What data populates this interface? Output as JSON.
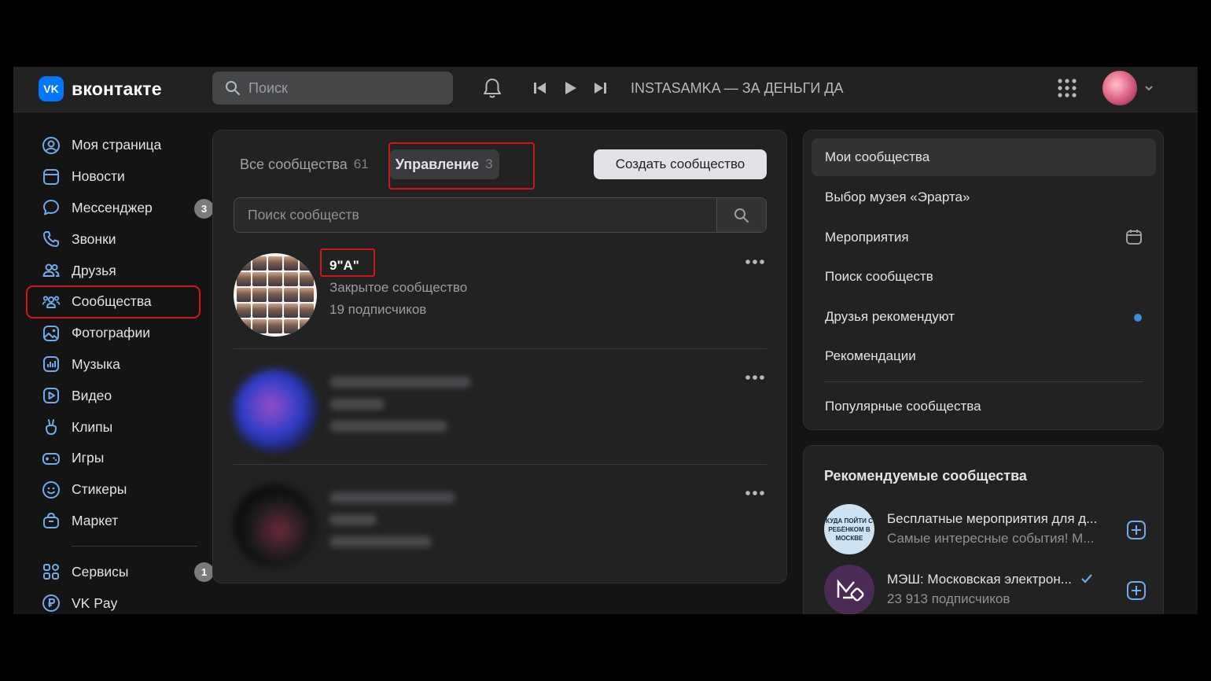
{
  "header": {
    "logo_mark": "VK",
    "logo_text": "вконтакте",
    "search_placeholder": "Поиск",
    "now_playing": "INSTASAMKA — ЗА ДЕНЬГИ ДА"
  },
  "sidebar": {
    "items": [
      {
        "label": "Моя страница",
        "icon": "user-circle-icon"
      },
      {
        "label": "Новости",
        "icon": "newspaper-icon"
      },
      {
        "label": "Мессенджер",
        "icon": "message-icon",
        "badge": "3"
      },
      {
        "label": "Звонки",
        "icon": "phone-icon"
      },
      {
        "label": "Друзья",
        "icon": "friends-icon"
      },
      {
        "label": "Сообщества",
        "icon": "communities-icon",
        "active": true
      },
      {
        "label": "Фотографии",
        "icon": "photo-icon"
      },
      {
        "label": "Музыка",
        "icon": "music-icon"
      },
      {
        "label": "Видео",
        "icon": "video-icon"
      },
      {
        "label": "Клипы",
        "icon": "clips-icon"
      },
      {
        "label": "Игры",
        "icon": "gamepad-icon"
      },
      {
        "label": "Стикеры",
        "icon": "smile-icon"
      },
      {
        "label": "Маркет",
        "icon": "market-bag-icon"
      }
    ],
    "bottom_items": [
      {
        "label": "Сервисы",
        "icon": "services-grid-icon",
        "badge": "1"
      },
      {
        "label": "VK Pay",
        "icon": "vkpay-icon"
      }
    ]
  },
  "main": {
    "tabs": [
      {
        "label": "Все сообщества",
        "count": "61"
      },
      {
        "label": "Управление",
        "count": "3",
        "selected": true
      }
    ],
    "create_button": "Создать сообщество",
    "search_placeholder": "Поиск сообществ",
    "groups": [
      {
        "name": "9\"А\"",
        "type": "Закрытое сообщество",
        "subscribers": "19 подписчиков"
      }
    ]
  },
  "right_menu": {
    "items": [
      {
        "label": "Мои сообщества",
        "selected": true
      },
      {
        "label": "Выбор музея «Эрарта»"
      },
      {
        "label": "Мероприятия",
        "icon": "calendar-icon"
      },
      {
        "label": "Поиск сообществ"
      },
      {
        "label": "Друзья рекомендуют",
        "dot": true
      },
      {
        "label": "Рекомендации"
      },
      {
        "label": "Популярные сообщества"
      }
    ]
  },
  "recommended": {
    "title": "Рекомендуемые сообщества",
    "items": [
      {
        "name": "Бесплатные мероприятия для д...",
        "subtitle": "Самые интересные события! М...",
        "avatar_text": "КУДА ПОЙТИ С РЕБЁНКОМ В МОСКВЕ"
      },
      {
        "name": "МЭШ: Московская электрон...",
        "subtitle": "23 913 подписчиков",
        "verified": true
      }
    ]
  },
  "colors": {
    "accent": "#0077ff",
    "highlight": "#d1151c",
    "link_dot": "#3f8ae0",
    "background": "#141414",
    "panel": "#222222"
  }
}
